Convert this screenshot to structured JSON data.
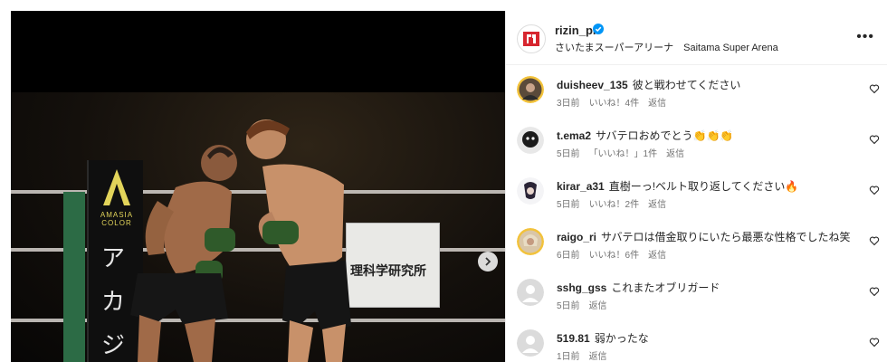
{
  "post": {
    "photo_alt": "Two MMA fighters clinching in a ring",
    "banner_brand": "AMASIA COLOR",
    "banner_kana": "アカジ",
    "sign_text": "理科学研究所"
  },
  "header": {
    "username": "rizin_pr",
    "location": "さいたまスーパーアリーナ　Saitama Super Arena",
    "more_label": "•••"
  },
  "comments": [
    {
      "user": "duisheev_135",
      "text": "彼と戦わせてください",
      "time": "3日前",
      "likes": "いいね！4件",
      "reply": "返信"
    },
    {
      "user": "t.ema2",
      "text": "サバテロおめでとう👏👏👏",
      "time": "5日前",
      "likes": "「いいね！」1件",
      "reply": "返信"
    },
    {
      "user": "kirar_a31",
      "text": "直樹ーっ!ベルト取り返してください🔥",
      "time": "5日前",
      "likes": "いいね！2件",
      "reply": "返信"
    },
    {
      "user": "raigo_ri",
      "text": "サバテロは借金取りにいたら最悪な性格でしたね笑",
      "time": "6日前",
      "likes": "いいね！6件",
      "reply": "返信"
    },
    {
      "user": "sshg_gss",
      "text": "これまたオブリガード",
      "time": "5日前",
      "likes": "",
      "reply": "返信"
    },
    {
      "user": "519.81",
      "text": "弱かったな",
      "time": "1日前",
      "likes": "",
      "reply": "返信"
    }
  ],
  "colors": {
    "verified": "#0095f6",
    "brand_red": "#d7262f",
    "meta": "#737373"
  }
}
